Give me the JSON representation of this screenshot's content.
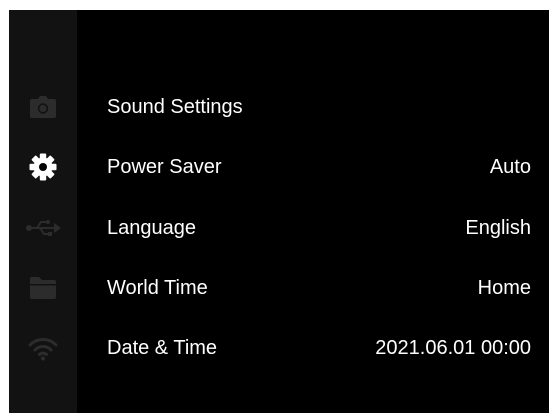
{
  "sidebar": {
    "items": [
      {
        "icon": "camera-icon",
        "active": false
      },
      {
        "icon": "gear-icon",
        "active": true
      },
      {
        "icon": "usb-icon",
        "active": false
      },
      {
        "icon": "folder-icon",
        "active": false
      },
      {
        "icon": "wifi-icon",
        "active": false
      }
    ]
  },
  "menu": {
    "items": [
      {
        "label": "Sound Settings",
        "value": ""
      },
      {
        "label": "Power Saver",
        "value": "Auto"
      },
      {
        "label": "Language",
        "value": "English"
      },
      {
        "label": "World Time",
        "value": "Home"
      },
      {
        "label": "Date & Time",
        "value": "2021.06.01 00:00"
      }
    ]
  },
  "colors": {
    "background": "#000000",
    "sidebar": "#121212",
    "active_icon": "#ffffff",
    "inactive_icon": "#2c2c2c",
    "text": "#ffffff"
  }
}
